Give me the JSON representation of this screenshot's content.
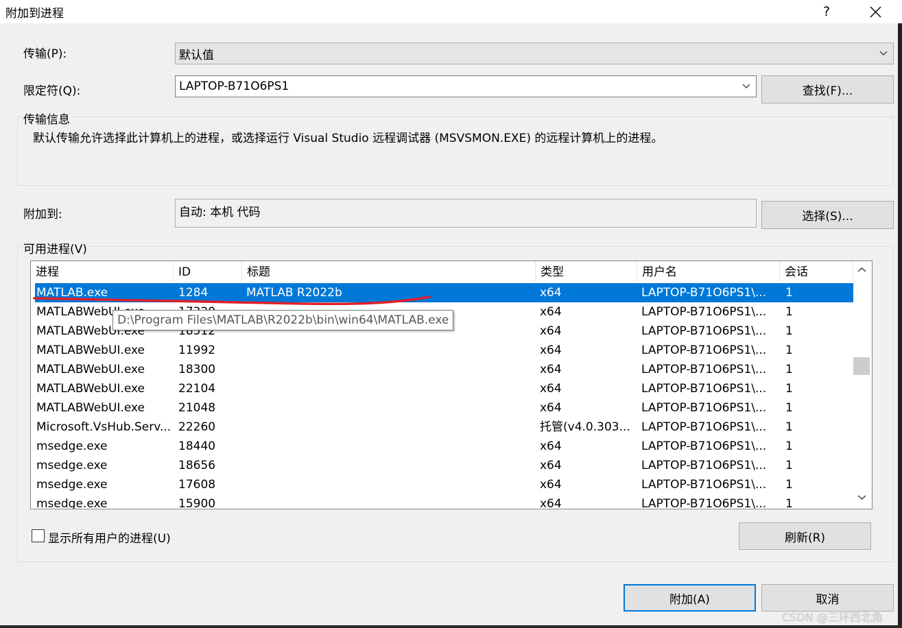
{
  "window": {
    "title": "附加到进程",
    "help_label": "?"
  },
  "transport": {
    "label": "传输(P):",
    "value": "默认值"
  },
  "qualifier": {
    "label": "限定符(Q):",
    "value": "LAPTOP-B71O6PS1",
    "find_button": "查找(F)..."
  },
  "transport_info": {
    "title": "传输信息",
    "text": "默认传输允许选择此计算机上的进程，或选择运行 Visual Studio 远程调试器 (MSVSMON.EXE) 的远程计算机上的进程。"
  },
  "attach_to": {
    "label": "附加到:",
    "value": "自动: 本机 代码",
    "select_button": "选择(S)..."
  },
  "processes": {
    "title": "可用进程(V)",
    "columns": [
      "进程",
      "ID",
      "标题",
      "类型",
      "用户名",
      "会话"
    ],
    "rows": [
      {
        "process": "MATLAB.exe",
        "id": "1284",
        "title": "MATLAB R2022b",
        "type": "x64",
        "user": "LAPTOP-B71O6PS1\\...",
        "session": "1"
      },
      {
        "process": "MATLABWebUI.exe",
        "id": "17320",
        "title": "",
        "type": "x64",
        "user": "LAPTOP-B71O6PS1\\...",
        "session": "1"
      },
      {
        "process": "MATLABWebUI.exe",
        "id": "18512",
        "title": "",
        "type": "x64",
        "user": "LAPTOP-B71O6PS1\\...",
        "session": "1"
      },
      {
        "process": "MATLABWebUI.exe",
        "id": "11992",
        "title": "",
        "type": "x64",
        "user": "LAPTOP-B71O6PS1\\...",
        "session": "1"
      },
      {
        "process": "MATLABWebUI.exe",
        "id": "18300",
        "title": "",
        "type": "x64",
        "user": "LAPTOP-B71O6PS1\\...",
        "session": "1"
      },
      {
        "process": "MATLABWebUI.exe",
        "id": "22104",
        "title": "",
        "type": "x64",
        "user": "LAPTOP-B71O6PS1\\...",
        "session": "1"
      },
      {
        "process": "MATLABWebUI.exe",
        "id": "21048",
        "title": "",
        "type": "x64",
        "user": "LAPTOP-B71O6PS1\\...",
        "session": "1"
      },
      {
        "process": "Microsoft.VsHub.Serv...",
        "id": "22260",
        "title": "",
        "type": "托管(v4.0.303...",
        "user": "LAPTOP-B71O6PS1\\...",
        "session": "1"
      },
      {
        "process": "msedge.exe",
        "id": "18440",
        "title": "",
        "type": "x64",
        "user": "LAPTOP-B71O6PS1\\...",
        "session": "1"
      },
      {
        "process": "msedge.exe",
        "id": "18656",
        "title": "",
        "type": "x64",
        "user": "LAPTOP-B71O6PS1\\...",
        "session": "1"
      },
      {
        "process": "msedge.exe",
        "id": "17608",
        "title": "",
        "type": "x64",
        "user": "LAPTOP-B71O6PS1\\...",
        "session": "1"
      },
      {
        "process": "msedge.exe",
        "id": "15900",
        "title": "",
        "type": "x64",
        "user": "LAPTOP-B71O6PS1\\...",
        "session": "1"
      }
    ],
    "selected_index": 0,
    "tooltip": "D:\\Program Files\\MATLAB\\R2022b\\bin\\win64\\MATLAB.exe",
    "show_all_users_label": "显示所有用户的进程(U)",
    "show_all_users_checked": false,
    "refresh_button": "刷新(R)"
  },
  "footer": {
    "attach_button": "附加(A)",
    "cancel_button": "取消"
  },
  "watermark": "CSDN @三环西北角",
  "colors": {
    "selection": "#0078d7",
    "annotation_stroke": "#e0202a"
  }
}
